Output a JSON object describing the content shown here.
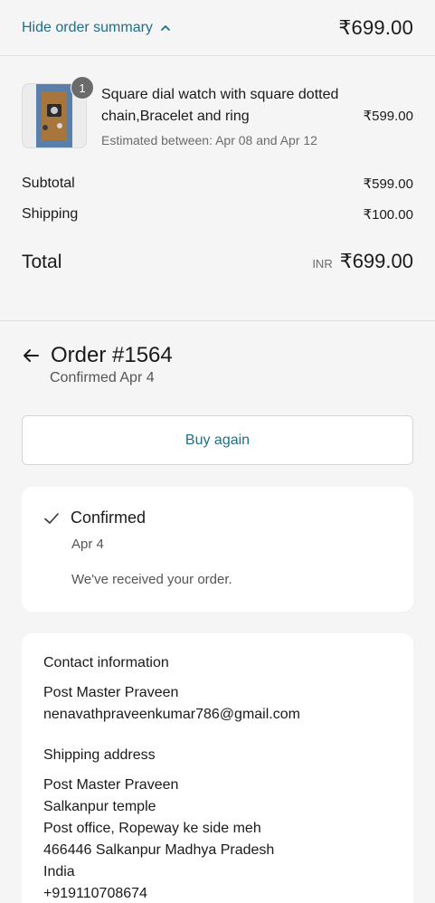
{
  "topbar": {
    "toggle_label": "Hide order summary",
    "total": "₹699.00"
  },
  "summary": {
    "item": {
      "quantity": "1",
      "title": "Square dial watch with square dotted chain,Bracelet and ring",
      "eta": "Estimated between: Apr 08 and Apr 12",
      "price": "₹599.00"
    },
    "subtotal_label": "Subtotal",
    "subtotal_value": "₹599.00",
    "shipping_label": "Shipping",
    "shipping_value": "₹100.00",
    "total_label": "Total",
    "currency": "INR",
    "total_value": "₹699.00"
  },
  "order": {
    "title": "Order #1564",
    "subtitle": "Confirmed Apr 4",
    "buy_again": "Buy again"
  },
  "status": {
    "title": "Confirmed",
    "date": "Apr 4",
    "message": "We've received your order."
  },
  "contact": {
    "title": "Contact information",
    "name": "Post Master Praveen",
    "email": "nenavathpraveenkumar786@gmail.com"
  },
  "shipping_address": {
    "title": "Shipping address",
    "lines": [
      "Post Master Praveen",
      "Salkanpur temple",
      "Post office, Ropeway ke side meh",
      "466446 Salkanpur Madhya Pradesh",
      "India",
      "+919110708674"
    ]
  },
  "colors": {
    "accent": "#1f6f8b",
    "background": "#f5f5f5",
    "card": "#ffffff"
  }
}
